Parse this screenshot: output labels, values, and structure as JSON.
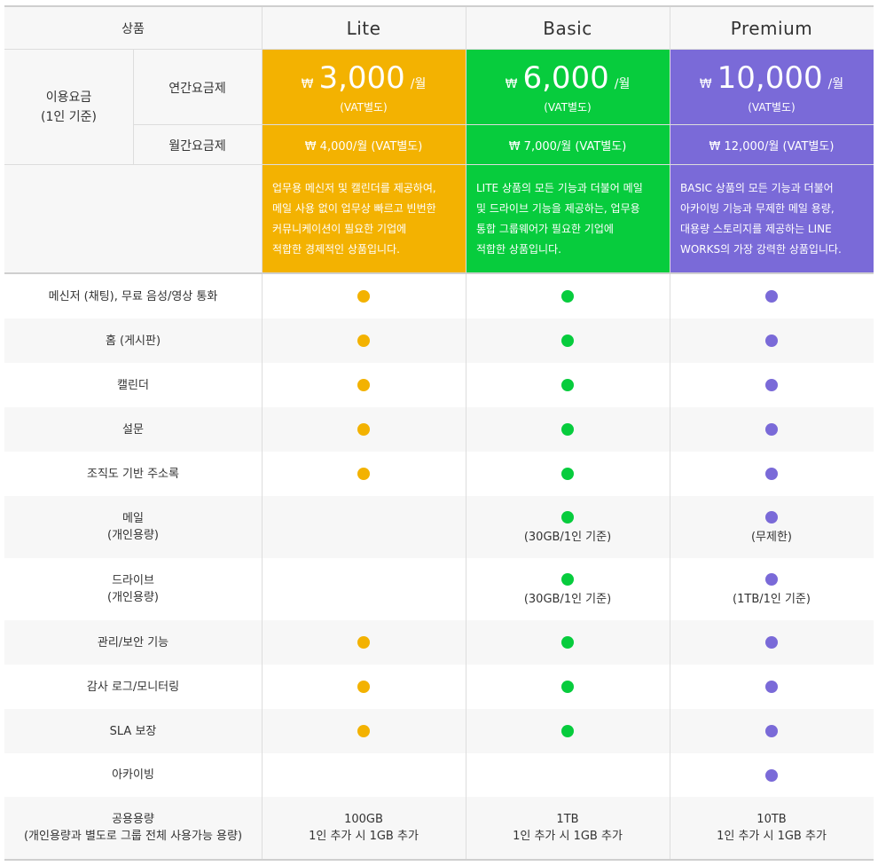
{
  "header": {
    "product_label": "상품",
    "plans": [
      "Lite",
      "Basic",
      "Premium"
    ]
  },
  "pricing": {
    "group_label_line1": "이용요금",
    "group_label_line2": "(1인 기준)",
    "annual_label": "연간요금제",
    "monthly_label": "월간요금제",
    "currency": "₩",
    "per": "/월",
    "vat_note": "(VAT별도)",
    "annual": [
      "3,000",
      "6,000",
      "10,000"
    ],
    "monthly": [
      "₩  4,000/월 (VAT별도)",
      "₩  7,000/월 (VAT별도)",
      "₩  12,000/월 (VAT별도)"
    ]
  },
  "descriptions": [
    [
      "업무용 메신저 및 캘린더를 제공하여,",
      "메일 사용 없이 업무상 빠르고 빈번한",
      "커뮤니케이션이 필요한 기업에",
      "적합한 경제적인 상품입니다."
    ],
    [
      "LITE 상품의 모든 기능과 더불어 메일",
      "및 드라이브 기능을 제공하는, 업무용",
      "통합 그룹웨어가 필요한 기업에",
      "적합한 상품입니다."
    ],
    [
      "BASIC 상품의 모든 기능과 더불어",
      "아카이빙 기능과 무제한 메일 용량,",
      "대용량 스토리지를 제공하는 LINE",
      "WORKS의 가장 강력한 상품입니다."
    ]
  ],
  "features": [
    {
      "label": "메신저 (채팅), 무료 음성/영상  통화",
      "sub": "",
      "lite": true,
      "basic": true,
      "premium": true,
      "notes": [
        "",
        "",
        ""
      ]
    },
    {
      "label": "홈 (게시판)",
      "sub": "",
      "lite": true,
      "basic": true,
      "premium": true,
      "notes": [
        "",
        "",
        ""
      ]
    },
    {
      "label": "캘린더",
      "sub": "",
      "lite": true,
      "basic": true,
      "premium": true,
      "notes": [
        "",
        "",
        ""
      ]
    },
    {
      "label": "설문",
      "sub": "",
      "lite": true,
      "basic": true,
      "premium": true,
      "notes": [
        "",
        "",
        ""
      ]
    },
    {
      "label": "조직도 기반 주소록",
      "sub": "",
      "lite": true,
      "basic": true,
      "premium": true,
      "notes": [
        "",
        "",
        ""
      ]
    },
    {
      "label": "메일",
      "sub": "(개인용량)",
      "lite": false,
      "basic": true,
      "premium": true,
      "notes": [
        "",
        "(30GB/1인 기준)",
        "(무제한)"
      ]
    },
    {
      "label": "드라이브",
      "sub": "(개인용량)",
      "lite": false,
      "basic": true,
      "premium": true,
      "notes": [
        "",
        "(30GB/1인 기준)",
        "(1TB/1인 기준)"
      ]
    },
    {
      "label": "관리/보안 기능",
      "sub": "",
      "lite": true,
      "basic": true,
      "premium": true,
      "notes": [
        "",
        "",
        ""
      ]
    },
    {
      "label": "감사 로그/모니터링",
      "sub": "",
      "lite": true,
      "basic": true,
      "premium": true,
      "notes": [
        "",
        "",
        ""
      ]
    },
    {
      "label": "SLA 보장",
      "sub": "",
      "lite": true,
      "basic": true,
      "premium": true,
      "notes": [
        "",
        "",
        ""
      ]
    },
    {
      "label": "아카이빙",
      "sub": "",
      "lite": false,
      "basic": false,
      "premium": true,
      "notes": [
        "",
        "",
        ""
      ]
    }
  ],
  "storage": {
    "label": "공용용량",
    "sub": "(개인용량과 별도로 그룹 전체 사용가능 용량)",
    "values": [
      [
        "100GB",
        "1인 추가 시 1GB 추가"
      ],
      [
        "1TB",
        "1인 추가 시 1GB 추가"
      ],
      [
        "10TB",
        "1인 추가 시 1GB 추가"
      ]
    ]
  },
  "colors": {
    "lite": "#f3b201",
    "basic": "#07cc3d",
    "premium": "#7a6ad8"
  }
}
